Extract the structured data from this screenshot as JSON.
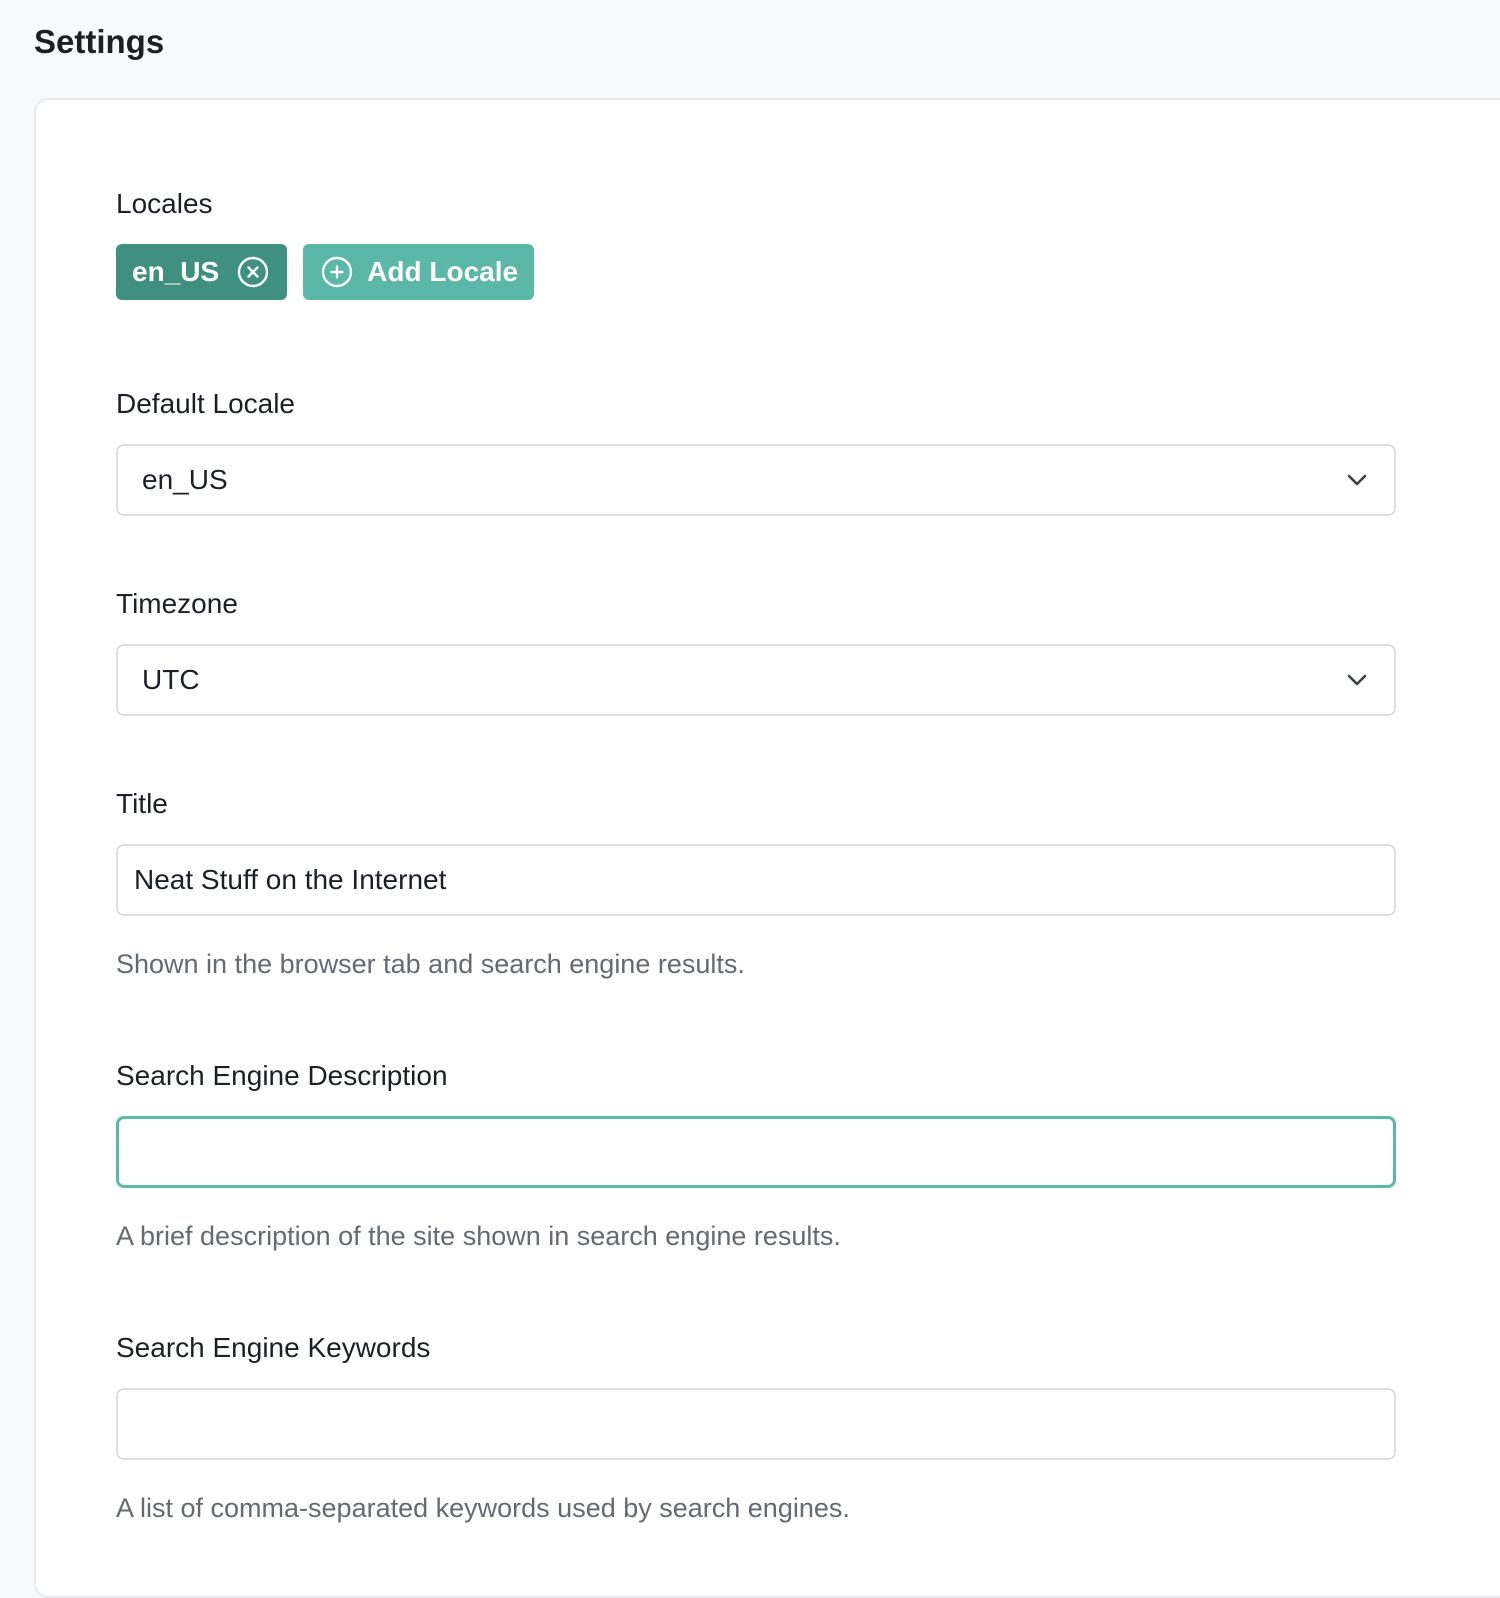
{
  "page": {
    "title": "Settings"
  },
  "colors": {
    "accent_dark": "#3f9081",
    "accent": "#5bb7a7",
    "focus_border": "#5bb7a7"
  },
  "locales": {
    "label": "Locales",
    "items": [
      {
        "code": "en_US",
        "remove_icon": "close-circle-icon"
      }
    ],
    "add_button": {
      "label": "Add Locale",
      "icon": "plus-circle-icon"
    }
  },
  "default_locale": {
    "label": "Default Locale",
    "value": "en_US",
    "icon": "chevron-down-icon"
  },
  "timezone": {
    "label": "Timezone",
    "value": "UTC",
    "icon": "chevron-down-icon"
  },
  "title_field": {
    "label": "Title",
    "value": "Neat Stuff on the Internet",
    "hint": "Shown in the browser tab and search engine results."
  },
  "search_description": {
    "label": "Search Engine Description",
    "value": "",
    "hint": "A brief description of the site shown in search engine results."
  },
  "search_keywords": {
    "label": "Search Engine Keywords",
    "value": "",
    "hint": "A list of comma-separated keywords used by search engines."
  }
}
